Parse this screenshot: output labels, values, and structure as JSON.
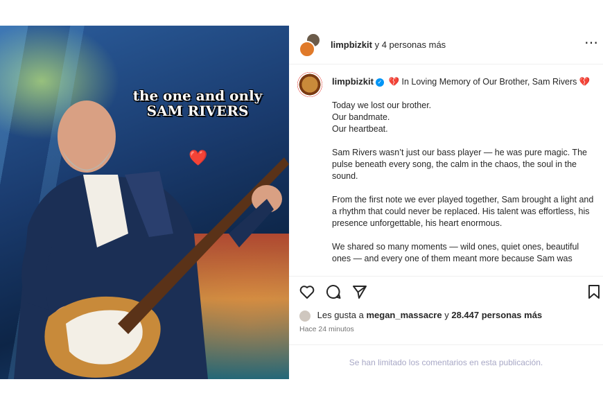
{
  "post_image": {
    "caption_line1": "the one and only",
    "caption_line2": "SAM RIVERS",
    "heart": "❤️"
  },
  "header": {
    "username": "limpbizkit",
    "suffix": "y 4 personas más",
    "more_icon": "⋯"
  },
  "caption": {
    "username": "limpbizkit",
    "verified_icon": "✓",
    "heart_icon": "💔",
    "title": "In Loving Memory of Our Brother, Sam Rivers",
    "paragraphs": [
      [
        "Today we lost our brother.",
        "Our bandmate.",
        "Our heartbeat."
      ],
      [
        "Sam Rivers wasn’t just our bass player — he was pure magic. The pulse beneath every song, the calm in the chaos, the soul in the sound."
      ],
      [
        "From the first note we ever played together, Sam brought a light and a rhythm that could never be replaced. His talent was effortless, his presence unforgettable, his heart enormous."
      ],
      [
        "We shared so many moments — wild ones, quiet ones, beautiful ones — and every one of them meant more because Sam was"
      ]
    ]
  },
  "actions": {
    "like_icon": "heart-outline-icon",
    "comment_icon": "comment-icon",
    "share_icon": "send-icon",
    "save_icon": "bookmark-icon"
  },
  "likes": {
    "prefix": "Les gusta a",
    "user": "megan_massacre",
    "middle": "y",
    "count": "28.447 personas más"
  },
  "timestamp": "Hace 24 minutos",
  "comments_notice": "Se han limitado los comentarios en esta publicación.",
  "colors": {
    "heart_red": "#e8192c",
    "verified_blue": "#0095f6",
    "muted": "#737373"
  }
}
